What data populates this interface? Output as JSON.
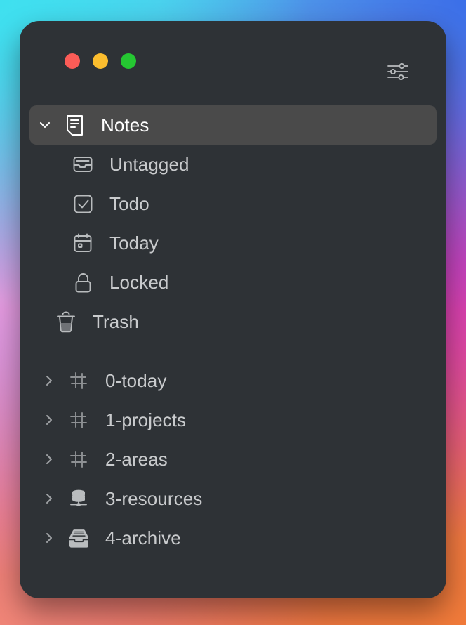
{
  "window": {
    "title": "Notes Sidebar",
    "controls": {
      "close_label": "Close",
      "minimize_label": "Minimize",
      "maximize_label": "Maximize"
    },
    "settings_icon": "sliders-icon",
    "colors": {
      "window_bg": "#2e3236",
      "row_selected_bg": "#4a4a4a",
      "text": "#c9cbcd",
      "text_selected": "#ffffff",
      "icon": "#b9bcbe",
      "traffic_red": "#fb5c57",
      "traffic_yellow": "#fbbd2e",
      "traffic_green": "#25c732"
    }
  },
  "sidebar": {
    "sections": [
      {
        "items": [
          {
            "label": "Notes",
            "icon": "note-document-icon",
            "chevron": "chevron-down",
            "selected": true,
            "indent": "root"
          },
          {
            "label": "Untagged",
            "icon": "inbox-tray-icon",
            "chevron": "none",
            "selected": false,
            "indent": "child"
          },
          {
            "label": "Todo",
            "icon": "checkbox-checked-icon",
            "chevron": "none",
            "selected": false,
            "indent": "child"
          },
          {
            "label": "Today",
            "icon": "calendar-icon",
            "chevron": "none",
            "selected": false,
            "indent": "child"
          },
          {
            "label": "Locked",
            "icon": "lock-icon",
            "chevron": "none",
            "selected": false,
            "indent": "child"
          },
          {
            "label": "Trash",
            "icon": "trash-icon",
            "chevron": "none",
            "selected": false,
            "indent": "trash"
          }
        ]
      },
      {
        "items": [
          {
            "label": "0-today",
            "icon": "crosshair-grid-icon",
            "chevron": "chevron-right",
            "selected": false,
            "indent": "folder"
          },
          {
            "label": "1-projects",
            "icon": "crosshair-grid-icon",
            "chevron": "chevron-right",
            "selected": false,
            "indent": "folder"
          },
          {
            "label": "2-areas",
            "icon": "crosshair-grid-icon",
            "chevron": "chevron-right",
            "selected": false,
            "indent": "folder"
          },
          {
            "label": "3-resources",
            "icon": "database-stack-icon",
            "chevron": "chevron-right",
            "selected": false,
            "indent": "folder"
          },
          {
            "label": "4-archive",
            "icon": "archive-box-icon",
            "chevron": "chevron-right",
            "selected": false,
            "indent": "folder"
          }
        ]
      }
    ]
  }
}
